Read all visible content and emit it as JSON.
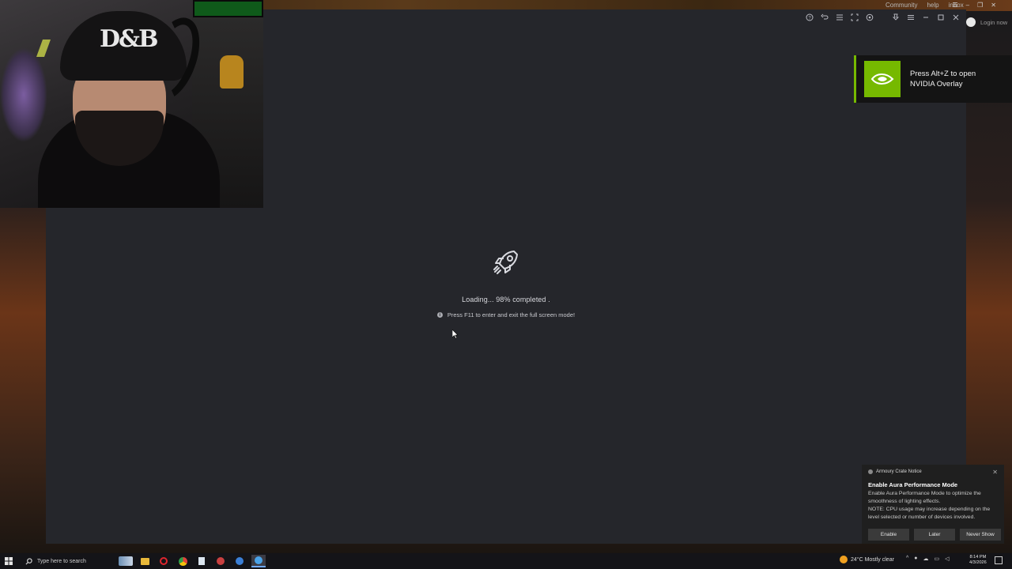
{
  "desktop": {
    "top_links": [
      "Community",
      "help",
      "inbox"
    ],
    "login_label": "Login now"
  },
  "app": {
    "title_icons": [
      "help-icon",
      "undo-icon",
      "list-icon",
      "fullscreen-icon",
      "settings-icon",
      "pin-icon",
      "menu-icon",
      "minimize-icon",
      "maximize-icon",
      "close-icon"
    ],
    "loading_text": "Loading... 98% completed .",
    "loading_progress_percent": 98,
    "hint_text": "Press F11 to enter and exit the full screen mode!"
  },
  "nvidia_toast": {
    "message": "Press Alt+Z to open NVIDIA Overlay",
    "accent_color": "#76b900"
  },
  "armoury_notice": {
    "header": "Armoury Crate Notice",
    "title": "Enable Aura Performance Mode",
    "body_line1": "Enable Aura Performance Mode to optimize the smoothness of lighting effects.",
    "body_line2": "NOTE: CPU usage may increase depending on the level selected or number of devices involved.",
    "buttons": [
      "Enable",
      "Later",
      "Never Show"
    ]
  },
  "taskbar": {
    "search_placeholder": "Type here to search",
    "weather": "24°C  Mostly clear",
    "time": "8:14 PM",
    "date": "4/3/2026"
  }
}
